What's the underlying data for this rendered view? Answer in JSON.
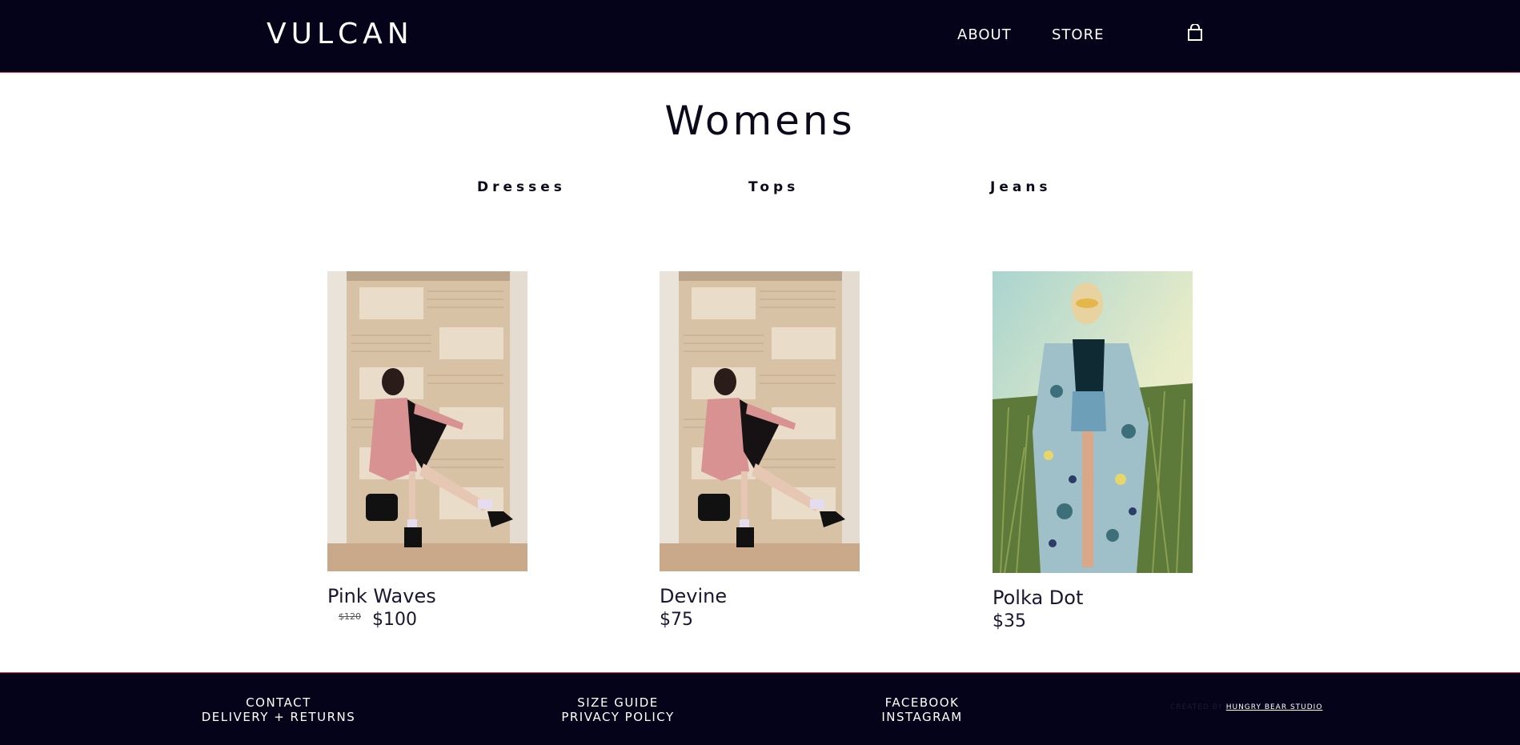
{
  "header": {
    "logo": "VULCAN",
    "nav": [
      "ABOUT",
      "STORE"
    ],
    "cart_icon": "shopping-bag-icon"
  },
  "page": {
    "title": "Womens",
    "categories": [
      "Dresses",
      "Tops",
      "Jeans"
    ]
  },
  "products": [
    {
      "name": "Pink Waves",
      "old_price": "$120",
      "price": "$100",
      "image": "woman-pink-coat-photo"
    },
    {
      "name": "Devine",
      "price": "$75",
      "image": "woman-pink-coat-photo"
    },
    {
      "name": "Polka Dot",
      "price": "$35",
      "image": "woman-floral-kimono-photo"
    }
  ],
  "footer": {
    "col1": [
      "CONTACT",
      "DELIVERY + RETURNS"
    ],
    "col2": [
      "SIZE GUIDE",
      "PRIVACY POLICY"
    ],
    "col3": [
      "FACEBOOK",
      "INSTAGRAM"
    ],
    "credit_prefix": "CREATED BY",
    "credit_link": "HUNGRY BEAR STUDIO"
  },
  "colors": {
    "header_bg": "#04031a",
    "accent_border": "#d03a4a",
    "text_dark": "#0b0a1a"
  }
}
